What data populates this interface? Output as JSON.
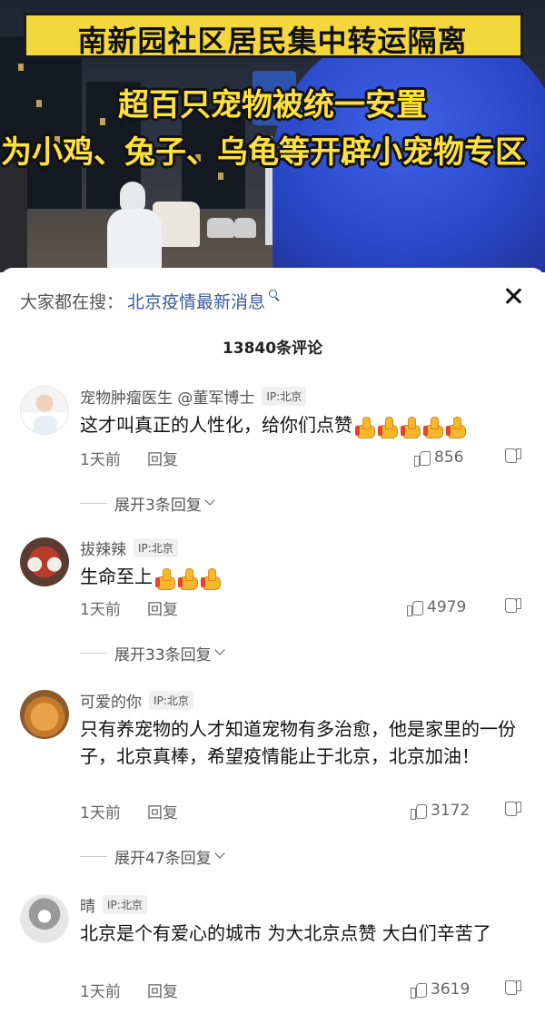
{
  "video": {
    "title": "南新园社区居民集中转运隔离",
    "subtitle_line1": "超百只宠物被统一安置",
    "subtitle_line2": "为小鸡、兔子、乌龟等开辟小宠物专区"
  },
  "search": {
    "prefix": "大家都在搜：",
    "query": "北京疫情最新消息"
  },
  "comment_count": "13840条评论",
  "comments": [
    {
      "name": "宠物肿瘤医生 @董军博士",
      "ip": "IP:北京",
      "text": "这才叫真正的人性化，给你们点赞",
      "thumbs": 5,
      "time": "1天前",
      "reply": "回复",
      "likes": "856",
      "expand": "展开3条回复"
    },
    {
      "name": "拔辣辣",
      "ip": "IP:北京",
      "text": "生命至上",
      "thumbs": 3,
      "time": "1天前",
      "reply": "回复",
      "likes": "4979",
      "expand": "展开33条回复"
    },
    {
      "name": "可爱的你",
      "ip": "IP:北京",
      "text": "只有养宠物的人才知道宠物有多治愈，他是家里的一份子，北京真棒，希望疫情能止于北京，北京加油！",
      "thumbs": 0,
      "time": "1天前",
      "reply": "回复",
      "likes": "3172",
      "expand": "展开47条回复"
    },
    {
      "name": "晴",
      "ip": "IP:北京",
      "text": "北京是个有爱心的城市 为大北京点赞 大白们辛苦了",
      "thumbs": 0,
      "time": "1天前",
      "reply": "回复",
      "likes": "3619",
      "expand": ""
    }
  ]
}
